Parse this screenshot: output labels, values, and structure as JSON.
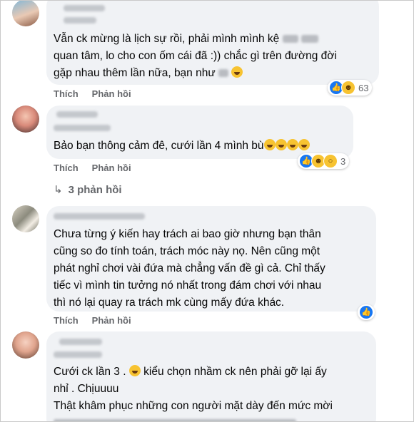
{
  "comments": [
    {
      "lines": [
        "Vẫn ck mừng là lịch sự rồi, phải mình mình kệ",
        "quan tâm, lo cho con ốm cái đã :)) chắc gì trên đường đời",
        "gặp nhau thêm lần nữa, bạn như"
      ],
      "actions": [
        "Thích",
        "Phản hồi"
      ],
      "reaction_count": "63"
    },
    {
      "lines": [
        "Bảo bạn thông cảm đê, cưới lần 4 mình bù"
      ],
      "actions": [
        "Thích",
        "Phản hồi"
      ],
      "reaction_count": "3",
      "replies": "3 phản hồi"
    },
    {
      "lines": [
        "Chưa từng ý kiến hay trách ai bao giờ nhưng bạn thân",
        "cũng so đo tính toán, trách móc này nọ. Nên cũng một",
        "phát nghỉ chơi vài đứa mà chẳng vấn đề gì cả. Chỉ thấy",
        "tiếc vì mình tin tưởng nó nhất trong đám chơi với nhau",
        "thì nó lại quay ra trách mk cùng mấy đứa khác."
      ],
      "actions": [
        "Thích",
        "Phản hồi"
      ]
    },
    {
      "lines": [
        "Cưới ck lần 3 .",
        "kiểu chọn nhầm ck nên phải gỡ lại ấy",
        "nhỉ . Chịuuuu",
        "Thật khâm phục những con người mặt dày đến mức mời"
      ]
    }
  ],
  "colors": {
    "bubble": "#f0f2f5",
    "muted": "#65676b",
    "like": "#1877f2",
    "haha": "#f7c331"
  },
  "icons": [
    "like-reaction-icon",
    "haha-reaction-icon",
    "wow-reaction-icon",
    "reply-arrow-icon"
  ]
}
